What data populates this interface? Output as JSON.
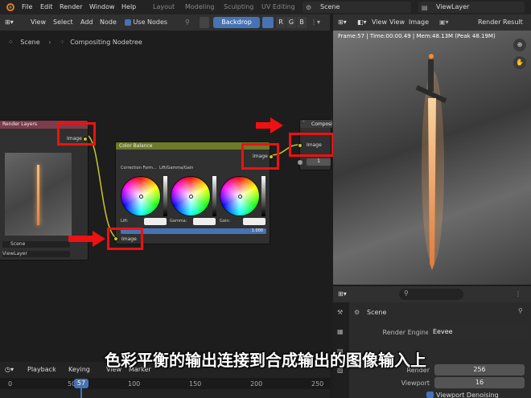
{
  "topbar": {
    "menus": [
      "File",
      "Edit",
      "Render",
      "Window",
      "Help"
    ],
    "workspaces": [
      "Layout",
      "Modeling",
      "Sculpting",
      "UV Editing"
    ],
    "scene": "Scene",
    "view_layer": "ViewLayer"
  },
  "node_header": {
    "menus": [
      "View",
      "Select",
      "Add",
      "Node"
    ],
    "use_nodes": "Use Nodes",
    "backdrop": "Backdrop",
    "channels": [
      "R",
      "G",
      "B"
    ],
    "breadcrumb_scene": "Scene",
    "breadcrumb_tree": "Compositing Nodetree"
  },
  "nodes": {
    "render_layers": {
      "title": "Render Layers",
      "output": "Image",
      "scene": "Scene",
      "layer": "ViewLayer"
    },
    "color_balance": {
      "title": "Color Balance",
      "output": "Image",
      "correction_label": "Correction Form...",
      "correction_value": "Lift/Gamma/Gain",
      "lift": "Lift:",
      "gamma": "Gamma:",
      "gain": "Gain:",
      "fac": "1.000",
      "input": "Image"
    },
    "composite": {
      "title": "Composite",
      "input": "Image",
      "alpha": "1"
    }
  },
  "viewer": {
    "menus": [
      "View",
      "View",
      "Image"
    ],
    "render_result": "Render Result",
    "info": "Frame:57 | Time:00:00.49 | Mem:48.13M (Peak 48.19M)"
  },
  "properties": {
    "scene": "Scene",
    "render_engine_label": "Render Engine",
    "render_engine": "Eevee",
    "render_label": "Render",
    "render_samples": "256",
    "viewport_label": "Viewport",
    "viewport_samples": "16",
    "viewport_denoising": "Viewport Denoising"
  },
  "timeline": {
    "playback": "Playback",
    "keying": "Keying",
    "view": "View",
    "marker": "Marker",
    "current_frame": "57",
    "ticks": [
      "0",
      "50",
      "100",
      "150",
      "200",
      "250"
    ]
  },
  "caption": "色彩平衡的输出连接到合成输出的图像输入上",
  "colors": {
    "socket": "#c7c729",
    "highlight": "#ee1111",
    "accent": "#4772b3"
  }
}
